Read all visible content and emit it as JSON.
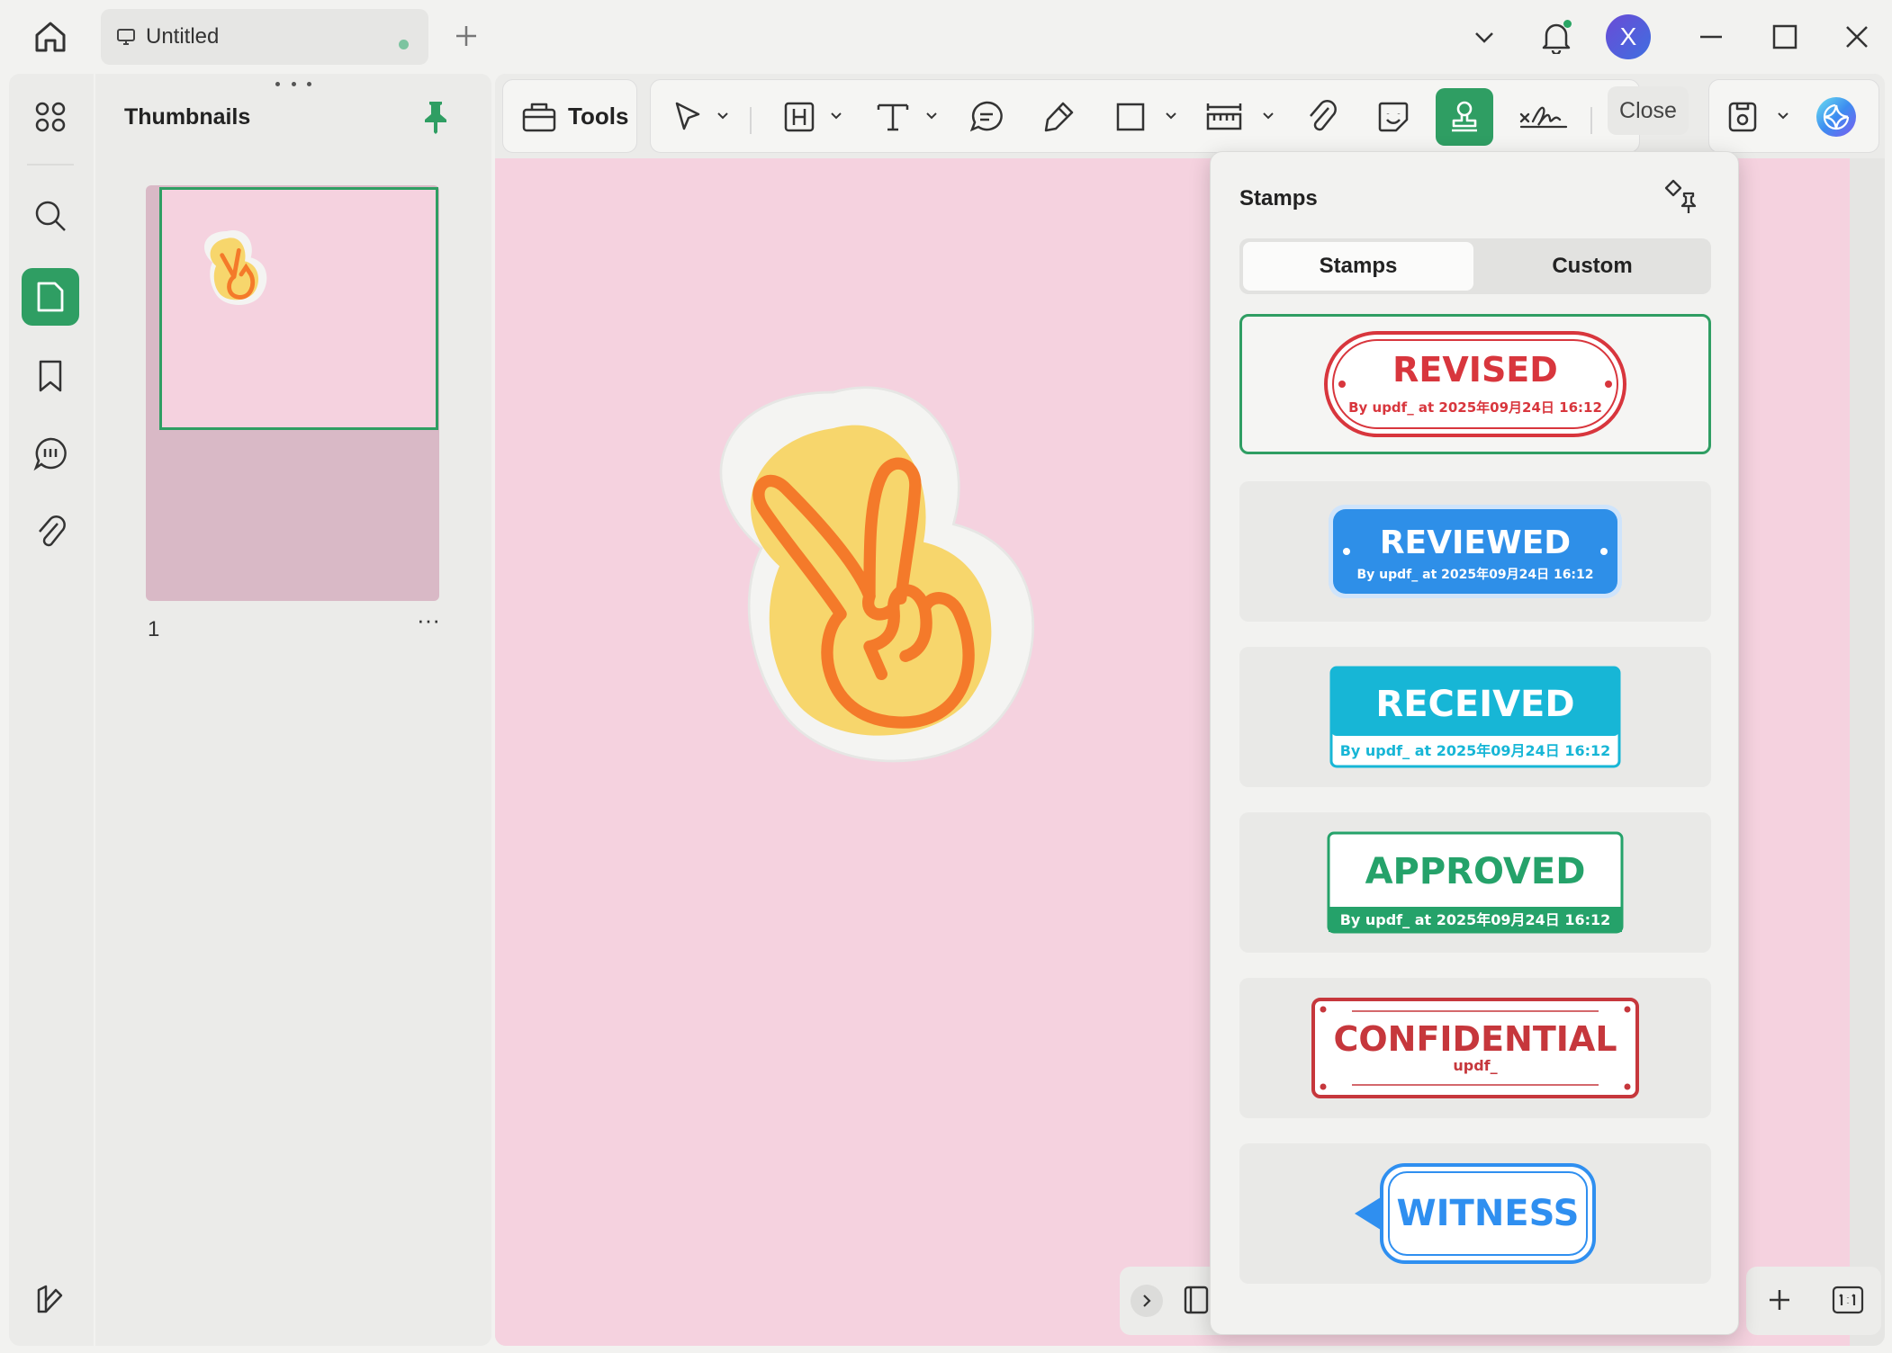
{
  "tab": {
    "title": "Untitled"
  },
  "user": {
    "initial": "X"
  },
  "thumbnails": {
    "title": "Thumbnails",
    "page_number": "1",
    "more": "···"
  },
  "toolbar": {
    "tools_label": "Tools",
    "close_label": "Close"
  },
  "stamps_panel": {
    "title": "Stamps",
    "tabs": [
      "Stamps",
      "Custom"
    ],
    "active_tab": "Stamps",
    "stamps": [
      {
        "main": "REVISED",
        "sub": "By updf_ at 2025年09月24日 16:12",
        "color": "#d8363d",
        "selected": true
      },
      {
        "main": "REVIEWED",
        "sub": "By updf_ at 2025年09月24日 16:12",
        "color": "#2e8fe8"
      },
      {
        "main": "RECEIVED",
        "sub": "By updf_ at 2025年09月24日 16:12",
        "color": "#17b6d6"
      },
      {
        "main": "APPROVED",
        "sub": "By updf_ at 2025年09月24日 16:12",
        "color": "#25a26a"
      },
      {
        "main": "CONFIDENTIAL",
        "sub": "updf_",
        "color": "#c6373c"
      },
      {
        "main": "WITNESS",
        "sub": "",
        "color": "#2f8ff0"
      }
    ]
  },
  "colors": {
    "accent": "#2f9e63",
    "canvas": "#f5d2df"
  }
}
